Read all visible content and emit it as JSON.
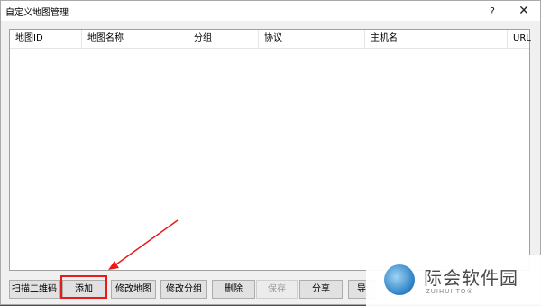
{
  "window": {
    "title": "自定义地图管理",
    "help_label": "?",
    "close_label": "✕"
  },
  "table": {
    "columns": [
      "地图ID",
      "地图名称",
      "分组",
      "协议",
      "主机名",
      "URL"
    ],
    "rows": []
  },
  "buttons": {
    "scan_qr": "扫描二维码",
    "add": "添加",
    "edit_map": "修改地图",
    "edit_group": "修改分组",
    "delete": "删除",
    "save": "保存",
    "share": "分享",
    "export": "导"
  },
  "watermark": {
    "text": "际会软件园",
    "sub": "ZUIHUI.TO®"
  },
  "colors": {
    "highlight": "#e81b1b",
    "window_bg": "#f0f0f0"
  }
}
